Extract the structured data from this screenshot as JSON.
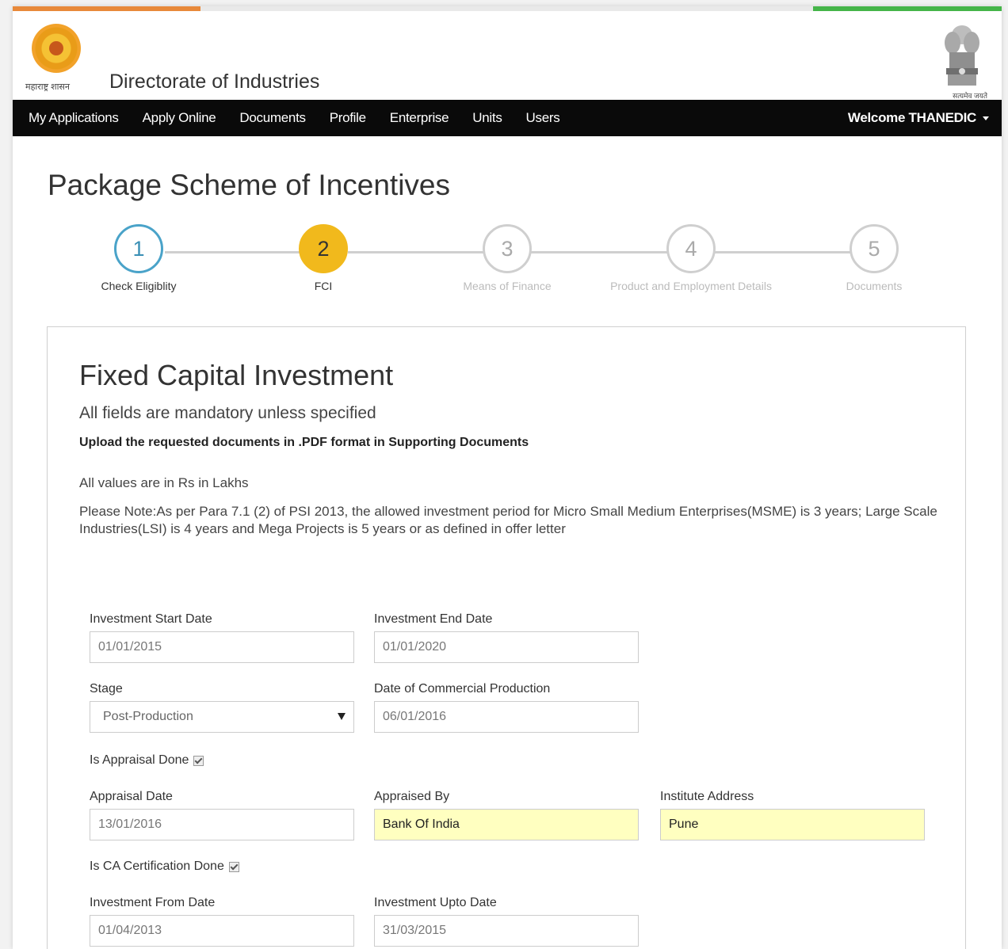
{
  "header": {
    "logo_caption": "महाराष्ट्र शासन",
    "site_title": "Directorate of Industries",
    "emblem_caption": "सत्यमेव जयते"
  },
  "nav": {
    "items": [
      "My Applications",
      "Apply Online",
      "Documents",
      "Profile",
      "Enterprise",
      "Units",
      "Users"
    ],
    "welcome": "Welcome THANEDIC"
  },
  "page_title": "Package Scheme of Incentives",
  "steps": [
    {
      "number": "1",
      "label": "Check Eligiblity",
      "state": "visited"
    },
    {
      "number": "2",
      "label": "FCI",
      "state": "active"
    },
    {
      "number": "3",
      "label": "Means of Finance",
      "state": "pending"
    },
    {
      "number": "4",
      "label": "Product and Employment Details",
      "state": "pending"
    },
    {
      "number": "5",
      "label": "Documents",
      "state": "pending"
    }
  ],
  "form": {
    "title": "Fixed Capital Investment",
    "subtitle": "All fields are mandatory unless specified",
    "upload_note": "Upload the requested documents in .PDF format in Supporting Documents",
    "values_note": "All values are in Rs in Lakhs",
    "para_note": "Please Note:As per Para 7.1 (2) of PSI 2013, the allowed investment period for Micro Small Medium Enterprises(MSME) is 3 years; Large Scale Industries(LSI) is 4 years and Mega Projects is 5 years or as defined in offer letter",
    "investment_start": {
      "label": "Investment Start Date",
      "value": "01/01/2015"
    },
    "investment_end": {
      "label": "Investment End Date",
      "value": "01/01/2020"
    },
    "stage": {
      "label": "Stage",
      "value": "Post-Production"
    },
    "commercial_production": {
      "label": "Date of Commercial Production",
      "value": "06/01/2016"
    },
    "appraisal_done": {
      "label": "Is Appraisal Done",
      "checked": true
    },
    "appraisal_date": {
      "label": "Appraisal Date",
      "value": "13/01/2016"
    },
    "appraised_by": {
      "label": "Appraised By",
      "value": "Bank Of India"
    },
    "institute_address": {
      "label": "Institute Address",
      "value": "Pune"
    },
    "ca_done": {
      "label": "Is CA Certification Done",
      "checked": true
    },
    "investment_from": {
      "label": "Investment From Date",
      "value": "01/04/2013"
    },
    "investment_upto": {
      "label": "Investment Upto Date",
      "value": "31/03/2015"
    }
  },
  "colors": {
    "saffron": "#e8893a",
    "green": "#45b549",
    "navbar": "#0a0a0a",
    "active_step": "#f1b91c",
    "visited_step": "#4aa3c9",
    "highlight_field": "#ffffc0"
  }
}
